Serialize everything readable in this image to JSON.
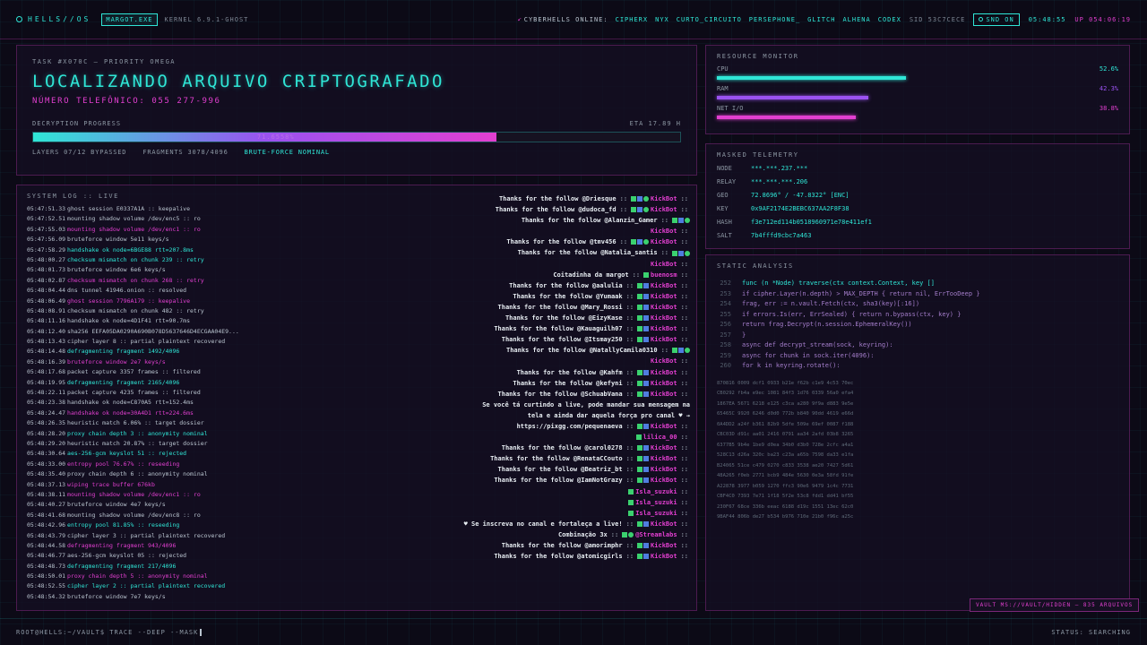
{
  "topbar": {
    "logo": "HELLS//OS",
    "user_chip": "MARGOT.EXE",
    "kernel": "KERNEL 6.9.1-GHOST",
    "online_label": "CYBERHELLS ONLINE:",
    "users": [
      "CIPHERX",
      "NYX",
      "CURTO_CIRCUITO",
      "PERSEPHONE_",
      "GLITCH",
      "ALHENA",
      "CODEX"
    ],
    "sid": "SID 53C7CECE",
    "sound": "SND ON",
    "clock": "05:48:55",
    "uptime": "UP 054:06:19"
  },
  "task": {
    "id": "TASK #X070C — PRIORITY OMEGA",
    "title": "LOCALIZANDO ARQUIVO CRIPTOGRAFADO",
    "phone": "NÚMERO TELEFÔNICO: 055 277-996",
    "progress_label": "DECRYPTION PROGRESS",
    "eta": "ETA 17.89 H",
    "progress": 0.716,
    "progress_text": "71.6558%",
    "stats": [
      "LAYERS 07/12 BYPASSED",
      "FRAGMENTS 3078/4096"
    ],
    "status": "BRUTE-FORCE NOMINAL"
  },
  "resource": {
    "title": "RESOURCE MONITOR",
    "rows": [
      {
        "label": "CPU",
        "value": "52.6%",
        "level": 0.526,
        "color": "#2fe6d6"
      },
      {
        "label": "RAM",
        "value": "42.3%",
        "level": 0.423,
        "color": "#9a52f0"
      },
      {
        "label": "NET I/O",
        "value": "38.8%",
        "level": 0.388,
        "color": "#e23fd0"
      }
    ]
  },
  "telemetry": {
    "title": "MASKED TELEMETRY",
    "rows": [
      {
        "key": "NODE",
        "value": "***.***.237.***"
      },
      {
        "key": "RELAY",
        "value": "***.***.***.206"
      },
      {
        "key": "GEO",
        "value": "72.8696° / -47.8322° [ENC]"
      },
      {
        "key": "KEY",
        "value": "0x9AF2174E2BEBC637AA2F8F38"
      },
      {
        "key": "HASH",
        "value": "f3e712ed114b0518960971e78e411ef1"
      },
      {
        "key": "SALT",
        "value": "7b4fffd9cbc7a463"
      }
    ]
  },
  "static": {
    "title": "STATIC ANALYSIS",
    "code": [
      {
        "n": "252",
        "text": "func (n *Node) traverse(ctx context.Context, key []",
        "style": "active"
      },
      {
        "n": "253",
        "text": "if cipher.Layer(n.depth) > MAX_DEPTH { return nil, ErrTooDeep }",
        "style": "muted"
      },
      {
        "n": "254",
        "text": "frag, err := n.vault.Fetch(ctx, sha3(key)[:16])",
        "style": "muted"
      },
      {
        "n": "255",
        "text": "if errors.Is(err, ErrSealed) { return n.bypass(ctx, key) }",
        "style": "muted"
      },
      {
        "n": "256",
        "text": "return frag.Decrypt(n.session.EphemeralKey())",
        "style": "muted"
      },
      {
        "n": "257",
        "text": "}",
        "style": "muted"
      },
      {
        "n": "258",
        "text": "async def decrypt_stream(sock, keyring):",
        "style": "muted"
      },
      {
        "n": "259",
        "text": "async for chunk in sock.iter(4096):",
        "style": "muted"
      },
      {
        "n": "260",
        "text": "for k in keyring.rotate():",
        "style": "muted"
      }
    ],
    "hex": [
      "870816 0009 dcf1 0933 b21e f62b c1e9 4c53 70ec",
      "CB0292 fb4a e9ec 1081 84f3 1d76 0339 56a0 efa4",
      "1867EA 5671 6218 e125 c3ca a280 9f9a d883 9e5e",
      "65465C 9920 6246 d0d0 772b b840 90dd 4619 e66d",
      "0A4DD2 a24f b361 82b9 5dfe 509e 69ef 0087 f188",
      "CBC03D d91c aa01 2416 0791 aa34 2afd 03b8 3265",
      "6377B5 9b4e 1be9 d0ea 34b0 d3b0 728e 2cfc a4a1",
      "528C13 d26a 320c ba23 c23a a65b 7598 da33 e1fa",
      "B24065 51ce c479 0270 c833 3538 ae20 7427 5d61",
      "48A265 f0eb 2771 bcb9 484e 5630 0e3a 58fd 91fe",
      "A22878 3977 b059 1270 ffc3 90e6 9479 1c4c 7731",
      "CBF4C0 7393 7e71 1f18 5f2e 53c8 fdd1 dd41 bf55",
      "230F67 68ce 336b eeac 6188 d19c 1551 13ec 62c0",
      "9BAF44 806b de27 b534 b976 710e 21b0 f96c a25c"
    ],
    "vault": "VAULT MS://VAULT/HIDDEN — 835 ARQUIVOS"
  },
  "log": {
    "title": "SYSTEM LOG :: LIVE",
    "lines": [
      {
        "ts": "05:47:51.33",
        "text": "ghost session E0337A1A :: keepalive",
        "c": "w"
      },
      {
        "ts": "05:47:52.51",
        "text": "mounting shadow volume /dev/enc5 :: ro",
        "c": "w"
      },
      {
        "ts": "05:47:55.03",
        "text": "mounting shadow volume /dev/enc1 :: ro",
        "c": "p"
      },
      {
        "ts": "05:47:56.09",
        "text": "bruteforce window 5e11 keys/s",
        "c": "w"
      },
      {
        "ts": "05:47:58.29",
        "text": "handshake ok node=6BGE88 rtt=207.8ms",
        "c": "c"
      },
      {
        "ts": "05:48:00.27",
        "text": "checksum mismatch on chunk 239 :: retry",
        "c": "c"
      },
      {
        "ts": "05:48:01.73",
        "text": "bruteforce window 6e6 keys/s",
        "c": "w"
      },
      {
        "ts": "05:48:02.87",
        "text": "checksum mismatch on chunk 268 :: retry",
        "c": "p"
      },
      {
        "ts": "05:48:04.44",
        "text": "dns tunnel 41946.onion :: resolved",
        "c": "w"
      },
      {
        "ts": "05:48:06.49",
        "text": "ghost session 7796A179 :: keepalive",
        "c": "p"
      },
      {
        "ts": "05:48:08.91",
        "text": "checksum mismatch on chunk 482 :: retry",
        "c": "w"
      },
      {
        "ts": "05:48:11.16",
        "text": "handshake ok node=4D1F41 rtt=90.7ms",
        "c": "w"
      },
      {
        "ts": "05:48:12.40",
        "text": "sha256 EEFA05DA0290A690B078D5637646D4ECGAA04E9...",
        "c": "w"
      },
      {
        "ts": "05:48:13.43",
        "text": "cipher layer 8 :: partial plaintext recovered",
        "c": "w"
      },
      {
        "ts": "05:48:14.48",
        "text": "defragmenting fragment 1492/4096",
        "c": "c"
      },
      {
        "ts": "05:48:16.39",
        "text": "bruteforce window 2e7 keys/s",
        "c": "p"
      },
      {
        "ts": "05:48:17.68",
        "text": "packet capture 3357 frames :: filtered",
        "c": "w"
      },
      {
        "ts": "05:48:19.95",
        "text": "defragmenting fragment 2165/4096",
        "c": "c"
      },
      {
        "ts": "05:48:22.11",
        "text": "packet capture 4235 frames :: filtered",
        "c": "w"
      },
      {
        "ts": "05:48:23.38",
        "text": "handshake ok node=C870A5 rtt=152.4ms",
        "c": "w"
      },
      {
        "ts": "05:48:24.47",
        "text": "handshake ok node=30A4D1 rtt=224.6ms",
        "c": "p"
      },
      {
        "ts": "05:48:26.35",
        "text": "heuristic match 6.06% :: target dossier",
        "c": "w"
      },
      {
        "ts": "05:48:28.20",
        "text": "proxy chain depth 3 :: anonymity nominal",
        "c": "c"
      },
      {
        "ts": "05:48:29.20",
        "text": "heuristic match 20.87% :: target dossier",
        "c": "w"
      },
      {
        "ts": "05:48:30.64",
        "text": "aes-256-gcm keyslot 51 :: rejected",
        "c": "c"
      },
      {
        "ts": "05:48:33.00",
        "text": "entropy pool 76.67% :: reseeding",
        "c": "p"
      },
      {
        "ts": "05:48:35.40",
        "text": "proxy chain depth 6 :: anonymity nominal",
        "c": "w"
      },
      {
        "ts": "05:48:37.13",
        "text": "wiping trace buffer 676kb",
        "c": "p"
      },
      {
        "ts": "05:48:38.11",
        "text": "mounting shadow volume /dev/enc1 :: ro",
        "c": "p"
      },
      {
        "ts": "05:48:40.27",
        "text": "bruteforce window 4e7 keys/s",
        "c": "w"
      },
      {
        "ts": "05:48:41.68",
        "text": "mounting shadow volume /dev/enc8 :: ro",
        "c": "w"
      },
      {
        "ts": "05:48:42.96",
        "text": "entropy pool 81.85% :: reseeding",
        "c": "c"
      },
      {
        "ts": "05:48:43.79",
        "text": "cipher layer 3 :: partial plaintext recovered",
        "c": "w"
      },
      {
        "ts": "05:48:44.58",
        "text": "defragmenting fragment 943/4096",
        "c": "p"
      },
      {
        "ts": "05:48:46.77",
        "text": "aes-256-gcm keyslot 05 :: rejected",
        "c": "w"
      },
      {
        "ts": "05:48:48.73",
        "text": "defragmenting fragment 217/4096",
        "c": "c"
      },
      {
        "ts": "05:48:50.01",
        "text": "proxy chain depth 5 :: anonymity nominal",
        "c": "p"
      },
      {
        "ts": "05:48:52.55",
        "text": "cipher layer 2 :: partial plaintext recovered",
        "c": "c"
      },
      {
        "ts": "05:48:54.32",
        "text": "bruteforce window 7e7 keys/s",
        "c": "w"
      }
    ]
  },
  "chat": [
    {
      "msg": "Thanks for the follow @Driesque",
      "user": "KickBot",
      "b": "gbc"
    },
    {
      "msg": "Thanks for the follow @dudoca_fd",
      "user": "KickBot",
      "b": "gbc"
    },
    {
      "msg": "Thanks for the follow @Alanzin_Gamer",
      "user": "",
      "b": "gbc"
    },
    {
      "msg": "",
      "user": "KickBot",
      "b": ""
    },
    {
      "msg": "Thanks for the follow @tmv456",
      "user": "KickBot",
      "b": "gbc"
    },
    {
      "msg": "Thanks for the follow @Natalia_santis",
      "user": "",
      "b": "gbc"
    },
    {
      "msg": "",
      "user": "KickBot",
      "b": ""
    },
    {
      "msg": "Coitadinha da margot",
      "user": "buenosm",
      "b": "g"
    },
    {
      "msg": "Thanks for the follow @aalulia",
      "user": "KickBot",
      "b": "gb"
    },
    {
      "msg": "Thanks for the follow @Yumaak",
      "user": "KickBot",
      "b": "gb"
    },
    {
      "msg": "Thanks for the follow @Mary_Rossi",
      "user": "KickBot",
      "b": "gb"
    },
    {
      "msg": "Thanks for the follow @EizyKase",
      "user": "KickBot",
      "b": "gb"
    },
    {
      "msg": "Thanks for the follow @Kauaguilh07",
      "user": "KickBot",
      "b": "gb"
    },
    {
      "msg": "Thanks for the follow @Itsmay250",
      "user": "KickBot",
      "b": "gb"
    },
    {
      "msg": "Thanks for the follow @NatallyCamila0310",
      "user": "",
      "b": "gbc"
    },
    {
      "msg": "",
      "user": "KickBot",
      "b": ""
    },
    {
      "msg": "Thanks for the follow @Kahfm",
      "user": "KickBot",
      "b": "gb"
    },
    {
      "msg": "Thanks for the follow @kefyni",
      "user": "KickBot",
      "b": "gb"
    },
    {
      "msg": "Thanks for the follow @SchuabVana",
      "user": "KickBot",
      "b": "gb"
    },
    {
      "msg": "Se você tá curtindo a live, pode mandar sua mensagem na",
      "user": "",
      "b": ""
    },
    {
      "msg": "tela e ainda dar aquela força pro canal ♥ →",
      "user": "",
      "b": ""
    },
    {
      "msg": "https://pixgg.com/pequenaeva",
      "user": "KickBot",
      "b": "gb"
    },
    {
      "msg": "",
      "user": "lilica_00",
      "b": "g"
    },
    {
      "msg": "Thanks for the follow @carol0278",
      "user": "KickBot",
      "b": "gb"
    },
    {
      "msg": "Thanks for the follow @RenataCCouto",
      "user": "KickBot",
      "b": "gb"
    },
    {
      "msg": "Thanks for the follow @Beatriz_bt",
      "user": "KickBot",
      "b": "gb"
    },
    {
      "msg": "Thanks for the follow @IamNotGrazy",
      "user": "KickBot",
      "b": "gb"
    },
    {
      "msg": "",
      "user": "Isla_suzuki",
      "b": "g"
    },
    {
      "msg": "",
      "user": "Isla_suzuki",
      "b": "g"
    },
    {
      "msg": "",
      "user": "Isla_suzuki",
      "b": "g"
    },
    {
      "msg": "♥ Se inscreva no canal e fortaleça a live!",
      "user": "KickBot",
      "b": "gb"
    },
    {
      "msg": "Combinação 3x",
      "user": "@Streamlabs",
      "b": "gc"
    },
    {
      "msg": "Thanks for the follow @amorimphr",
      "user": "KickBot",
      "b": "gb"
    },
    {
      "msg": "Thanks for the follow @atomicgirls",
      "user": "KickBot",
      "b": "gb"
    }
  ],
  "footer": {
    "prompt": "ROOT@HELLS:~/VAULT$ TRACE --DEEP --MASK",
    "status": "STATUS: SEARCHING"
  }
}
